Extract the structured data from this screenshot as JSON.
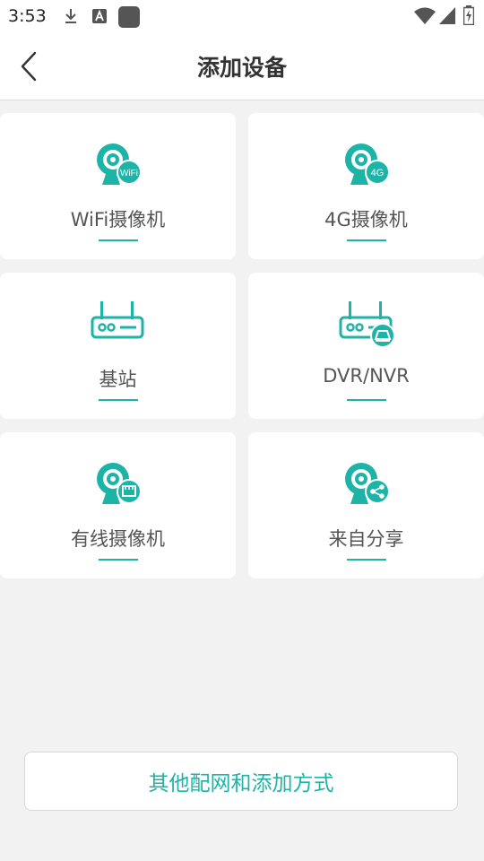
{
  "status_bar": {
    "time": "3:53",
    "icons": [
      "download-icon",
      "font-a-icon",
      "app-square-icon",
      "wifi-icon",
      "signal-icon",
      "battery-icon"
    ]
  },
  "header": {
    "title": "添加设备",
    "back_icon": "chevron-left-icon"
  },
  "devices": [
    {
      "label": "WiFi摄像机",
      "icon": "camera-wifi-icon"
    },
    {
      "label": "4G摄像机",
      "icon": "camera-4g-icon"
    },
    {
      "label": "基站",
      "icon": "router-icon"
    },
    {
      "label": "DVR/NVR",
      "icon": "dvr-nvr-icon"
    },
    {
      "label": "有线摄像机",
      "icon": "camera-wired-icon"
    },
    {
      "label": "来自分享",
      "icon": "camera-share-icon"
    }
  ],
  "footer": {
    "other_methods_label": "其他配网和添加方式"
  },
  "colors": {
    "accent": "#1db3a7",
    "background": "#f2f2f2",
    "card": "#ffffff"
  }
}
